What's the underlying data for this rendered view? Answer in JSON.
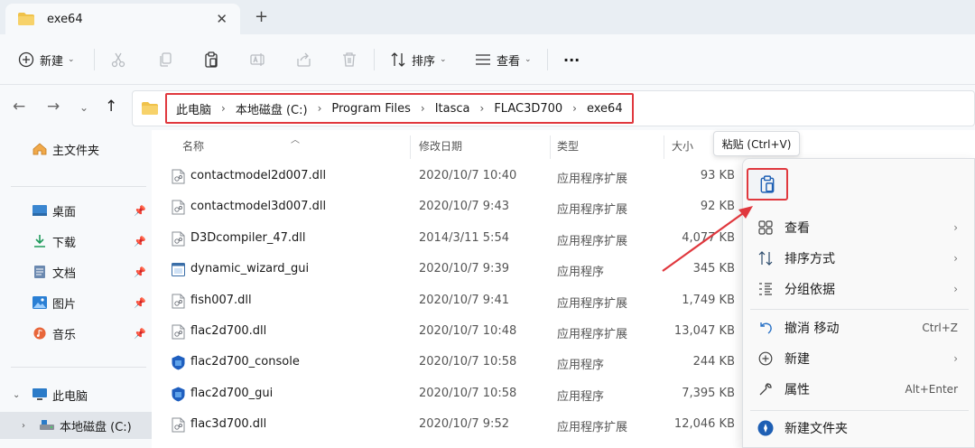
{
  "window": {
    "tab_title": "exe64",
    "close_glyph": "✕",
    "new_tab_glyph": "+"
  },
  "toolbar": {
    "new_label": "新建",
    "sort_label": "排序",
    "view_label": "查看",
    "more_glyph": "···"
  },
  "address": {
    "crumbs": [
      "此电脑",
      "本地磁盘 (C:)",
      "Program Files",
      "Itasca",
      "FLAC3D700",
      "exe64"
    ]
  },
  "sidebar": {
    "home": "主文件夹",
    "quick": [
      "桌面",
      "下载",
      "文档",
      "图片",
      "音乐"
    ],
    "this_pc": "此电脑",
    "local_disk": "本地磁盘 (C:)"
  },
  "columns": {
    "name": "名称",
    "date": "修改日期",
    "type": "类型",
    "size": "大小"
  },
  "files": [
    {
      "name": "contactmodel2d007.dll",
      "date": "2020/10/7 10:40",
      "type": "应用程序扩展",
      "size": "93 KB",
      "icon": "dll-icon"
    },
    {
      "name": "contactmodel3d007.dll",
      "date": "2020/10/7 9:43",
      "type": "应用程序扩展",
      "size": "92 KB",
      "icon": "dll-icon"
    },
    {
      "name": "D3Dcompiler_47.dll",
      "date": "2014/3/11 5:54",
      "type": "应用程序扩展",
      "size": "4,077 KB",
      "icon": "dll-icon"
    },
    {
      "name": "dynamic_wizard_gui",
      "date": "2020/10/7 9:39",
      "type": "应用程序",
      "size": "345 KB",
      "icon": "exe-icon"
    },
    {
      "name": "fish007.dll",
      "date": "2020/10/7 9:41",
      "type": "应用程序扩展",
      "size": "1,749 KB",
      "icon": "dll-icon"
    },
    {
      "name": "flac2d700.dll",
      "date": "2020/10/7 10:48",
      "type": "应用程序扩展",
      "size": "13,047 KB",
      "icon": "dll-icon"
    },
    {
      "name": "flac2d700_console",
      "date": "2020/10/7 10:58",
      "type": "应用程序",
      "size": "244 KB",
      "icon": "flac-icon"
    },
    {
      "name": "flac2d700_gui",
      "date": "2020/10/7 10:58",
      "type": "应用程序",
      "size": "7,395 KB",
      "icon": "flac-icon"
    },
    {
      "name": "flac3d700.dll",
      "date": "2020/10/7 9:52",
      "type": "应用程序扩展",
      "size": "12,046 KB",
      "icon": "dll-icon"
    }
  ],
  "tooltip": "粘贴 (Ctrl+V)",
  "context_menu": [
    {
      "label": "查看",
      "key": "",
      "submenu": true,
      "icon": "grid-icon"
    },
    {
      "label": "排序方式",
      "key": "",
      "submenu": true,
      "icon": "sort-icon"
    },
    {
      "label": "分组依据",
      "key": "",
      "submenu": true,
      "icon": "group-icon"
    },
    {
      "label": "撤消 移动",
      "key": "Ctrl+Z",
      "submenu": false,
      "icon": "undo-icon"
    },
    {
      "label": "新建",
      "key": "",
      "submenu": true,
      "icon": "new-icon"
    },
    {
      "label": "属性",
      "key": "Alt+Enter",
      "submenu": false,
      "icon": "properties-icon"
    },
    {
      "label": "新建文件夹",
      "key": "",
      "submenu": false,
      "icon": "new-folder-icon"
    }
  ],
  "colors": {
    "highlight": "#e0383e",
    "folder": "#f0c24a",
    "accent": "#1e5fb4"
  }
}
